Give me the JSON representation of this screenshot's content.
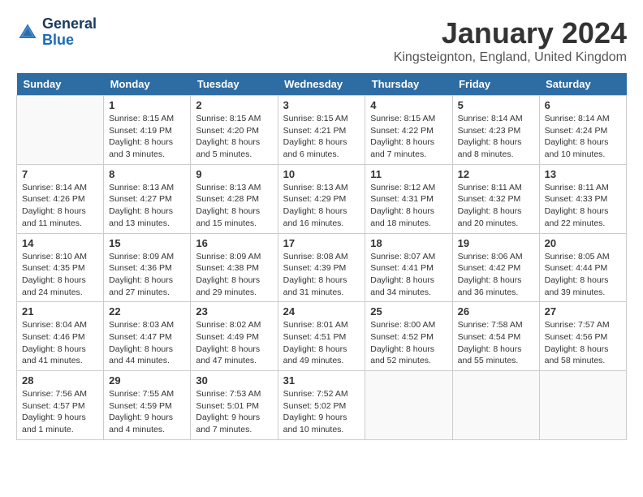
{
  "header": {
    "logo_line1": "General",
    "logo_line2": "Blue",
    "month": "January 2024",
    "location": "Kingsteignton, England, United Kingdom"
  },
  "days_of_week": [
    "Sunday",
    "Monday",
    "Tuesday",
    "Wednesday",
    "Thursday",
    "Friday",
    "Saturday"
  ],
  "weeks": [
    [
      {
        "date": "",
        "content": ""
      },
      {
        "date": "1",
        "content": "Sunrise: 8:15 AM\nSunset: 4:19 PM\nDaylight: 8 hours\nand 3 minutes."
      },
      {
        "date": "2",
        "content": "Sunrise: 8:15 AM\nSunset: 4:20 PM\nDaylight: 8 hours\nand 5 minutes."
      },
      {
        "date": "3",
        "content": "Sunrise: 8:15 AM\nSunset: 4:21 PM\nDaylight: 8 hours\nand 6 minutes."
      },
      {
        "date": "4",
        "content": "Sunrise: 8:15 AM\nSunset: 4:22 PM\nDaylight: 8 hours\nand 7 minutes."
      },
      {
        "date": "5",
        "content": "Sunrise: 8:14 AM\nSunset: 4:23 PM\nDaylight: 8 hours\nand 8 minutes."
      },
      {
        "date": "6",
        "content": "Sunrise: 8:14 AM\nSunset: 4:24 PM\nDaylight: 8 hours\nand 10 minutes."
      }
    ],
    [
      {
        "date": "7",
        "content": "Sunrise: 8:14 AM\nSunset: 4:26 PM\nDaylight: 8 hours\nand 11 minutes."
      },
      {
        "date": "8",
        "content": "Sunrise: 8:13 AM\nSunset: 4:27 PM\nDaylight: 8 hours\nand 13 minutes."
      },
      {
        "date": "9",
        "content": "Sunrise: 8:13 AM\nSunset: 4:28 PM\nDaylight: 8 hours\nand 15 minutes."
      },
      {
        "date": "10",
        "content": "Sunrise: 8:13 AM\nSunset: 4:29 PM\nDaylight: 8 hours\nand 16 minutes."
      },
      {
        "date": "11",
        "content": "Sunrise: 8:12 AM\nSunset: 4:31 PM\nDaylight: 8 hours\nand 18 minutes."
      },
      {
        "date": "12",
        "content": "Sunrise: 8:11 AM\nSunset: 4:32 PM\nDaylight: 8 hours\nand 20 minutes."
      },
      {
        "date": "13",
        "content": "Sunrise: 8:11 AM\nSunset: 4:33 PM\nDaylight: 8 hours\nand 22 minutes."
      }
    ],
    [
      {
        "date": "14",
        "content": "Sunrise: 8:10 AM\nSunset: 4:35 PM\nDaylight: 8 hours\nand 24 minutes."
      },
      {
        "date": "15",
        "content": "Sunrise: 8:09 AM\nSunset: 4:36 PM\nDaylight: 8 hours\nand 27 minutes."
      },
      {
        "date": "16",
        "content": "Sunrise: 8:09 AM\nSunset: 4:38 PM\nDaylight: 8 hours\nand 29 minutes."
      },
      {
        "date": "17",
        "content": "Sunrise: 8:08 AM\nSunset: 4:39 PM\nDaylight: 8 hours\nand 31 minutes."
      },
      {
        "date": "18",
        "content": "Sunrise: 8:07 AM\nSunset: 4:41 PM\nDaylight: 8 hours\nand 34 minutes."
      },
      {
        "date": "19",
        "content": "Sunrise: 8:06 AM\nSunset: 4:42 PM\nDaylight: 8 hours\nand 36 minutes."
      },
      {
        "date": "20",
        "content": "Sunrise: 8:05 AM\nSunset: 4:44 PM\nDaylight: 8 hours\nand 39 minutes."
      }
    ],
    [
      {
        "date": "21",
        "content": "Sunrise: 8:04 AM\nSunset: 4:46 PM\nDaylight: 8 hours\nand 41 minutes."
      },
      {
        "date": "22",
        "content": "Sunrise: 8:03 AM\nSunset: 4:47 PM\nDaylight: 8 hours\nand 44 minutes."
      },
      {
        "date": "23",
        "content": "Sunrise: 8:02 AM\nSunset: 4:49 PM\nDaylight: 8 hours\nand 47 minutes."
      },
      {
        "date": "24",
        "content": "Sunrise: 8:01 AM\nSunset: 4:51 PM\nDaylight: 8 hours\nand 49 minutes."
      },
      {
        "date": "25",
        "content": "Sunrise: 8:00 AM\nSunset: 4:52 PM\nDaylight: 8 hours\nand 52 minutes."
      },
      {
        "date": "26",
        "content": "Sunrise: 7:58 AM\nSunset: 4:54 PM\nDaylight: 8 hours\nand 55 minutes."
      },
      {
        "date": "27",
        "content": "Sunrise: 7:57 AM\nSunset: 4:56 PM\nDaylight: 8 hours\nand 58 minutes."
      }
    ],
    [
      {
        "date": "28",
        "content": "Sunrise: 7:56 AM\nSunset: 4:57 PM\nDaylight: 9 hours\nand 1 minute."
      },
      {
        "date": "29",
        "content": "Sunrise: 7:55 AM\nSunset: 4:59 PM\nDaylight: 9 hours\nand 4 minutes."
      },
      {
        "date": "30",
        "content": "Sunrise: 7:53 AM\nSunset: 5:01 PM\nDaylight: 9 hours\nand 7 minutes."
      },
      {
        "date": "31",
        "content": "Sunrise: 7:52 AM\nSunset: 5:02 PM\nDaylight: 9 hours\nand 10 minutes."
      },
      {
        "date": "",
        "content": ""
      },
      {
        "date": "",
        "content": ""
      },
      {
        "date": "",
        "content": ""
      }
    ]
  ]
}
